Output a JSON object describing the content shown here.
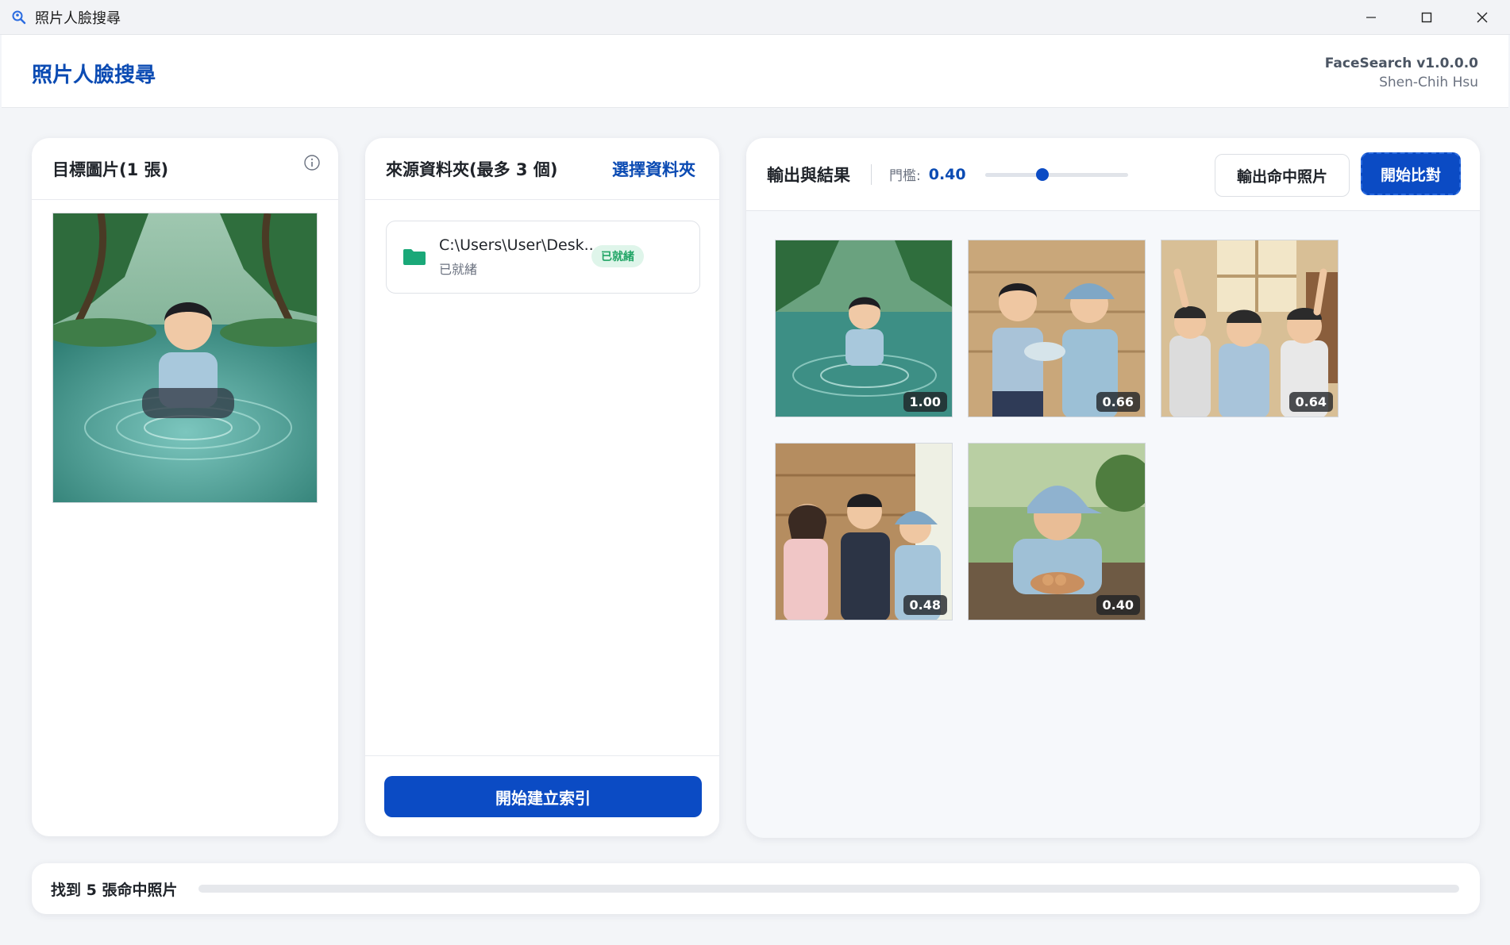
{
  "window": {
    "title": "照片人臉搜尋",
    "app_icon": "magnifier-icon",
    "controls": [
      "minimize-icon",
      "maximize-icon",
      "close-icon"
    ]
  },
  "header": {
    "app_title": "照片人臉搜尋",
    "version": "FaceSearch v1.0.0.0",
    "author": "Shen-Chih Hsu"
  },
  "target_panel": {
    "title": "目標圖片(1 張)",
    "info_icon": "info-icon"
  },
  "source_panel": {
    "title": "來源資料夾(最多 3 個)",
    "select_link": "選擇資料夾",
    "folders": [
      {
        "path": "C:\\Users\\User\\Desk...",
        "status": "已就緒",
        "badge": "已就緒"
      }
    ],
    "index_button": "開始建立索引"
  },
  "results_panel": {
    "title": "輸出與結果",
    "threshold_label": "門檻:",
    "threshold_value": "0.40",
    "threshold": 0.4,
    "export_button": "輸出命中照片",
    "compare_button": "開始比對",
    "results": [
      {
        "score": "1.00"
      },
      {
        "score": "0.66"
      },
      {
        "score": "0.64"
      },
      {
        "score": "0.48"
      },
      {
        "score": "0.40"
      }
    ]
  },
  "status": {
    "text": "找到 5 張命中照片",
    "progress": 0
  },
  "colors": {
    "accent": "#0b4bc4",
    "brand_text": "#0b4bb3",
    "ready_badge_bg": "#dff5ea",
    "ready_badge_text": "#22a566",
    "folder_icon": "#1aa878"
  }
}
